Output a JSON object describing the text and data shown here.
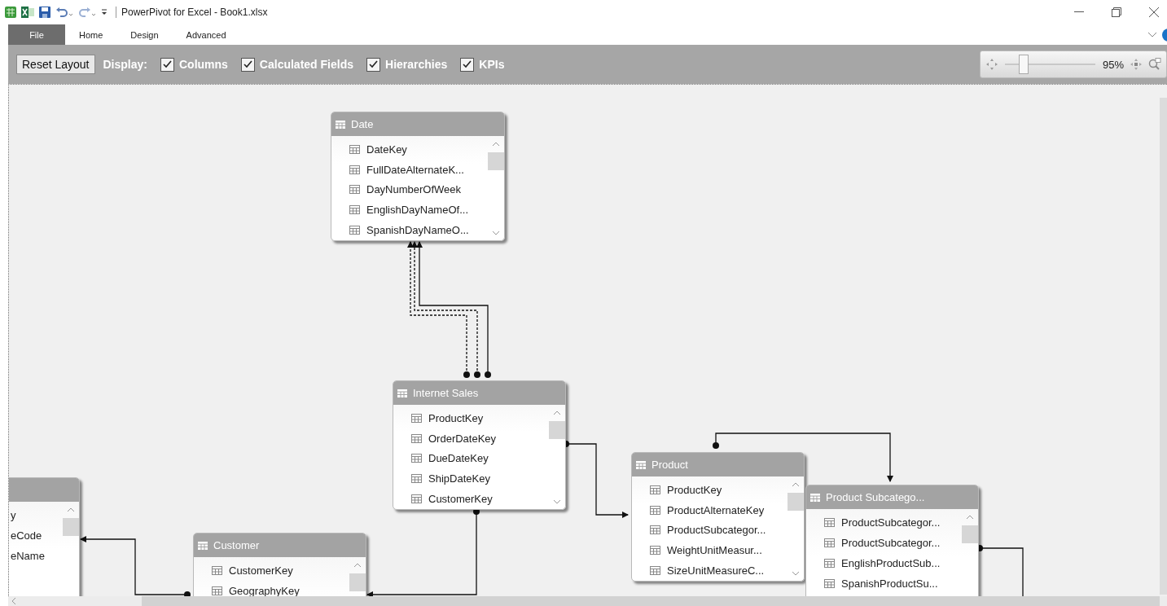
{
  "window": {
    "title": "PowerPivot for Excel - Book1.xlsx"
  },
  "ribbon_tabs": [
    {
      "label": "File",
      "selected": true
    },
    {
      "label": "Home",
      "selected": false
    },
    {
      "label": "Design",
      "selected": false
    },
    {
      "label": "Advanced",
      "selected": false
    }
  ],
  "toolbar": {
    "reset_button": "Reset Layout",
    "display_label": "Display:",
    "options": [
      {
        "label": "Columns",
        "checked": true
      },
      {
        "label": "Calculated Fields",
        "checked": true
      },
      {
        "label": "Hierarchies",
        "checked": true
      },
      {
        "label": "KPIs",
        "checked": true
      }
    ],
    "zoom": {
      "level": 0.15,
      "reading": "95%"
    }
  },
  "diagram": {
    "tables": [
      {
        "title": "Date",
        "columns": [
          "DateKey",
          "FullDateAlternateK...",
          "DayNumberOfWeek",
          "EnglishDayNameOf...",
          "SpanishDayNameO..."
        ]
      },
      {
        "title": "Internet Sales",
        "columns": [
          "ProductKey",
          "OrderDateKey",
          "DueDateKey",
          "ShipDateKey",
          "CustomerKey"
        ]
      },
      {
        "title": "Product",
        "columns": [
          "ProductKey",
          "ProductAlternateKey",
          "ProductSubcategor...",
          "WeightUnitMeasur...",
          "SizeUnitMeasureC..."
        ]
      },
      {
        "title": "Product Subcatego...",
        "columns": [
          "ProductSubcategor...",
          "ProductSubcategor...",
          "EnglishProductSub...",
          "SpanishProductSu..."
        ]
      },
      {
        "title": "Customer",
        "columns": [
          "CustomerKey",
          "GeographyKey"
        ]
      },
      {
        "columns": [
          "y",
          "eCode",
          "eName"
        ]
      }
    ]
  }
}
